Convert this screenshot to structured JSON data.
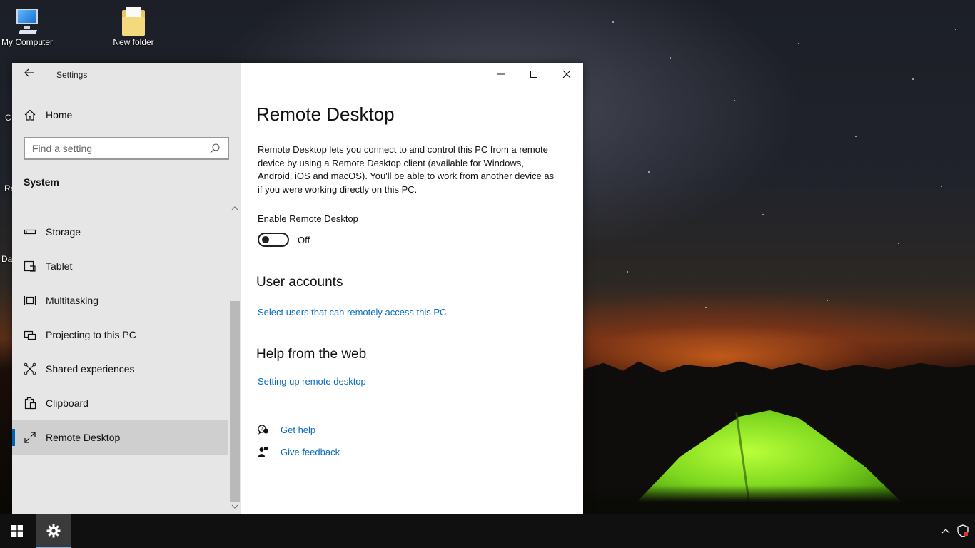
{
  "desktop": {
    "icons": [
      {
        "label": "My Computer",
        "icon": "my-computer-icon"
      },
      {
        "label": "New folder",
        "icon": "folder-icon"
      }
    ],
    "partial_labels": [
      "C",
      "Re",
      "Da"
    ]
  },
  "settings_window": {
    "app_title": "Settings",
    "sidebar": {
      "home_label": "Home",
      "search_placeholder": "Find a setting",
      "section_title": "System",
      "items": [
        {
          "label": "Storage",
          "icon": "storage-icon",
          "selected": false
        },
        {
          "label": "Tablet",
          "icon": "tablet-icon",
          "selected": false
        },
        {
          "label": "Multitasking",
          "icon": "multitasking-icon",
          "selected": false
        },
        {
          "label": "Projecting to this PC",
          "icon": "projecting-icon",
          "selected": false
        },
        {
          "label": "Shared experiences",
          "icon": "shared-experiences-icon",
          "selected": false
        },
        {
          "label": "Clipboard",
          "icon": "clipboard-icon",
          "selected": false
        },
        {
          "label": "Remote Desktop",
          "icon": "remote-desktop-icon",
          "selected": true
        }
      ]
    },
    "content": {
      "title": "Remote Desktop",
      "description": "Remote Desktop lets you connect to and control this PC from a remote device by using a Remote Desktop client (available for Windows, Android, iOS and macOS). You'll be able to work from another device as if you were working directly on this PC.",
      "enable_label": "Enable Remote Desktop",
      "toggle_state": "Off",
      "toggle_on": false,
      "user_accounts_heading": "User accounts",
      "user_accounts_link": "Select users that can remotely access this PC",
      "help_heading": "Help from the web",
      "help_link": "Setting up remote desktop",
      "get_help": "Get help",
      "give_feedback": "Give feedback"
    }
  },
  "taskbar": {
    "items": [
      "start-icon",
      "settings-gear-icon"
    ],
    "tray": [
      "chevron-up-icon",
      "security-shield-icon"
    ]
  },
  "colors": {
    "accent": "#0063b1",
    "link": "#0a6cbd",
    "sidebar_bg": "#e6e6e6",
    "selected_bg": "#cfcfcf",
    "taskbar_bg": "#101010"
  }
}
